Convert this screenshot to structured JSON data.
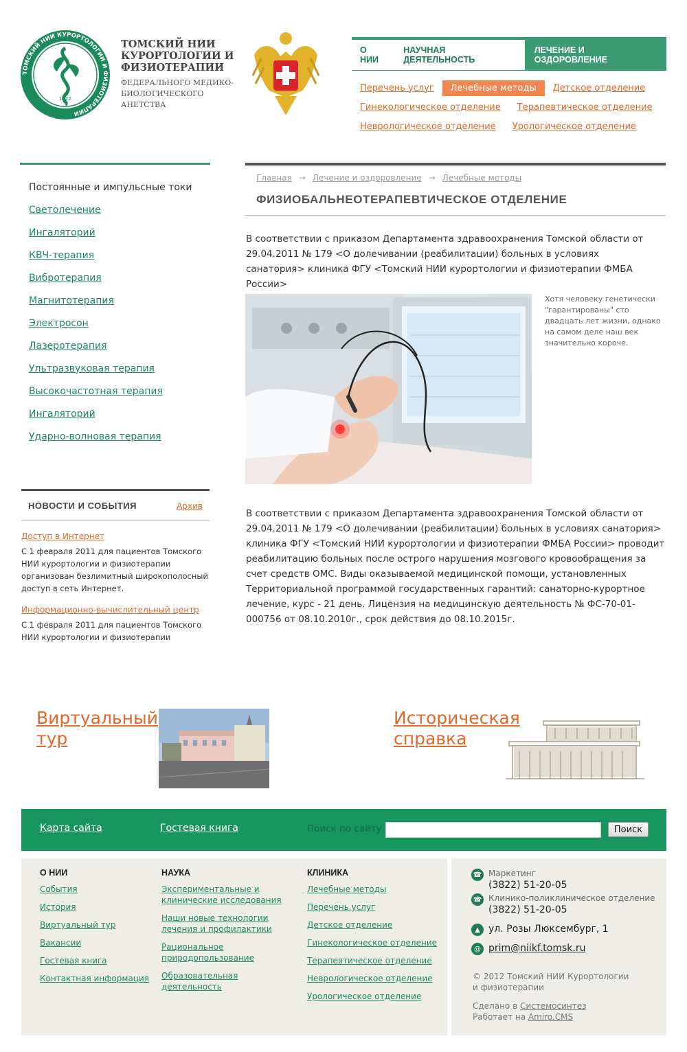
{
  "header": {
    "org_name": "ТОМСКИЙ НИИ КУРОРТОЛОГИИ И ФИЗИОТЕРАПИИ",
    "org_sub": "ФЕДЕРАЛЬНОГО МЕДИКО-БИОЛОГИЧЕСКОГО АНЕТСТВА",
    "logo_ring_text": "ТОМСКИЙ НИИ КУРОРТОЛОГИИ И ФИЗИОТЕРАПИИ",
    "logo_year": "1922"
  },
  "topnav": [
    {
      "label": "О НИИ"
    },
    {
      "label": "НАУЧНАЯ ДЕЯТЕЛЬНОСТЬ"
    },
    {
      "label": "ЛЕЧЕНИЕ И ОЗДОРОВЛЕНИЕ",
      "active": true
    }
  ],
  "subnav": {
    "row1": [
      "Перечень услуг",
      "Лечебные методы",
      "Детское отделение"
    ],
    "row2": [
      "Гинекологическое отделение",
      "Терапевтическое отделение"
    ],
    "row3": [
      "Неврологическое отделение",
      "Урологическое отделение"
    ],
    "active": "Лечебные методы"
  },
  "left_menu": [
    "Постоянные и импульсные токи",
    "Светолечение",
    "Ингаляторий",
    "КВЧ-терапия",
    "Вибротерапия",
    "Магнитотерапия",
    "Электросон",
    "Лазеротерапия",
    "Ультразвуковая терапия",
    "Высокочастотная терапия",
    "Ингаляторий",
    "Ударно-волновая терапия"
  ],
  "news": {
    "title": "НОВОСТИ И СОБЫТИЯ",
    "archive": "Архив",
    "items": [
      {
        "link": "Доступ в Интернет",
        "text": "С 1 февраля 2011 для пациентов Томского НИИ курортологии и физиотерапии организован безлимитный широкополосный доступ в сеть Интернет."
      },
      {
        "link": "Информационно-вычислительный центр",
        "text": "С 1 февраля 2011 для пациентов Томского НИИ курортологии и физиотерапии"
      }
    ]
  },
  "breadcrumbs": [
    "Главная",
    "Лечение и оздоровление",
    "Лечебные методы"
  ],
  "breadcrumb_sep": "→",
  "page_title": "ФИЗИОБАЛЬНЕОТЕРАПЕВТИЧЕСКОЕ ОТДЕЛЕНИЕ",
  "para1": "В соответствии с приказом Департамента здравоохранения Томской области от 29.04.2011 № 179 <О долечивании (реабилитации) больных в условиях санатория> клиника ФГУ <Томский НИИ курортологии и физиотерапии ФМБА России>",
  "caption": "Хотя человеку генетически \"гарантированы\" сто двадцать лет жизни, однако на самом деле наш век значительно короче.",
  "para2": "В соответствии с приказом Департамента здравоохранения Томской области от 29.04.2011 № 179 <О долечивании (реабилитации) больных в условиях санатория> клиника ФГУ <Томский НИИ курортологии и физиотерапии ФМБА России> проводит реабилитацию больных после острого нарушения мозгового кровообращения за счет средств ОМС. Виды оказываемой медицинской помощи, установленных Территориальной программой государственных гарантий: санаторно-курортное лечение, курс - 21 день. Лицензия на медицинскую деятельность № ФС-70-01-000756 от 08.10.2010г., срок действия до 08.10.2015г.",
  "promo": {
    "virtual_tour": "Виртуальный тур",
    "history": "Историческая справка"
  },
  "footer_bar": {
    "sitemap": "Карта сайта",
    "guestbook": "Гостевая книга",
    "search_label": "Поиск по сайту",
    "search_value": "",
    "search_button": "Поиск"
  },
  "footer_cols": {
    "about": {
      "title": "О НИИ",
      "links": [
        "События",
        "История",
        "Виртуальный тур",
        "Вакансии",
        "Гостевая книга",
        "Контактная информация"
      ]
    },
    "science": {
      "title": "НАУКА",
      "links": [
        "Экспериментальные и клинические исследования",
        "Наши новые технологии лечения и профилактики",
        "Рациональное природопользование",
        "Образовательная деятельность"
      ]
    },
    "clinic": {
      "title": "КЛИНИКА",
      "links": [
        "Лечебные методы",
        "Перечень услуг",
        "Детское отделение",
        "Гинекологическое отделение",
        "Терапевтическое отделение",
        "Неврологическое отделение",
        "Урологическое отделение"
      ]
    }
  },
  "contacts": {
    "marketing_label": "Маркетинг",
    "marketing_phone": "(3822) 51-20-05",
    "clinic_label": "Клинико-поликлиническое отделение",
    "clinic_phone": "(3822) 51-20-05",
    "address": "ул. Розы Люксембург, 1",
    "email": "prim@niikf.tomsk.ru"
  },
  "copyright": "© 2012  Томский НИИ Курортологии и физиотерапии",
  "madeby": {
    "made_prefix": "Сделано в",
    "made_link": "Системосинтез",
    "runs_prefix": "Работает на",
    "runs_link": "Amiro.CMS"
  },
  "colors": {
    "green": "#3a9a72",
    "footer_green": "#16965d",
    "orange": "#e2692a"
  }
}
